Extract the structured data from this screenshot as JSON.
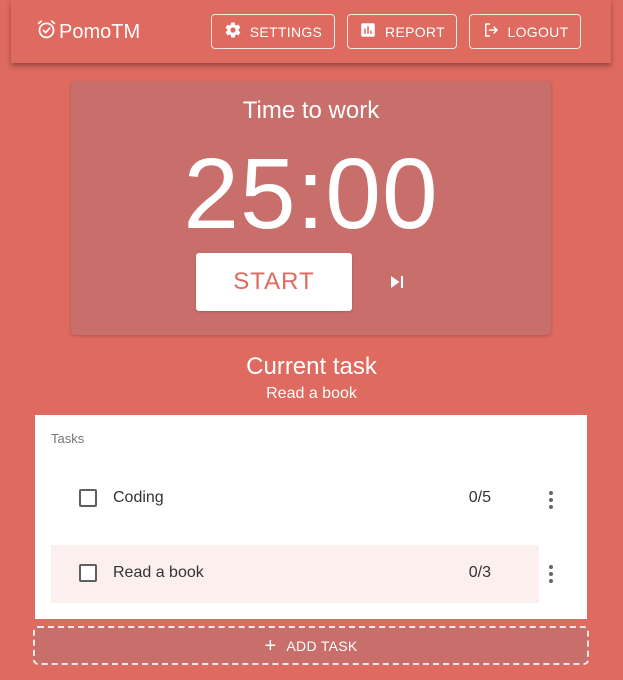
{
  "app": {
    "brand": "PomoTM"
  },
  "header": {
    "settings_label": "SETTINGS",
    "report_label": "REPORT",
    "logout_label": "LOGOUT"
  },
  "timer": {
    "mode_label": "Time to work",
    "time": "25:00",
    "start_label": "START"
  },
  "current_task": {
    "title": "Current task",
    "name": "Read a book"
  },
  "tasks": {
    "header": "Tasks",
    "items": [
      {
        "name": "Coding",
        "count": "0/5",
        "checked": false
      },
      {
        "name": "Read a book",
        "count": "0/3",
        "checked": false,
        "selected": true
      }
    ]
  },
  "add_task": {
    "label": "ADD TASK",
    "icon": "+"
  },
  "colors": {
    "background": "#df6a5f",
    "timer_card": "#c86e6b",
    "selected_row": "#fbf0ee"
  },
  "icons": {
    "brand": "alarm-clock-icon",
    "settings": "gear-icon",
    "report": "bar-chart-icon",
    "logout": "logout-icon",
    "skip": "skip-next-icon",
    "more": "more-vertical-icon",
    "add": "plus-icon"
  }
}
